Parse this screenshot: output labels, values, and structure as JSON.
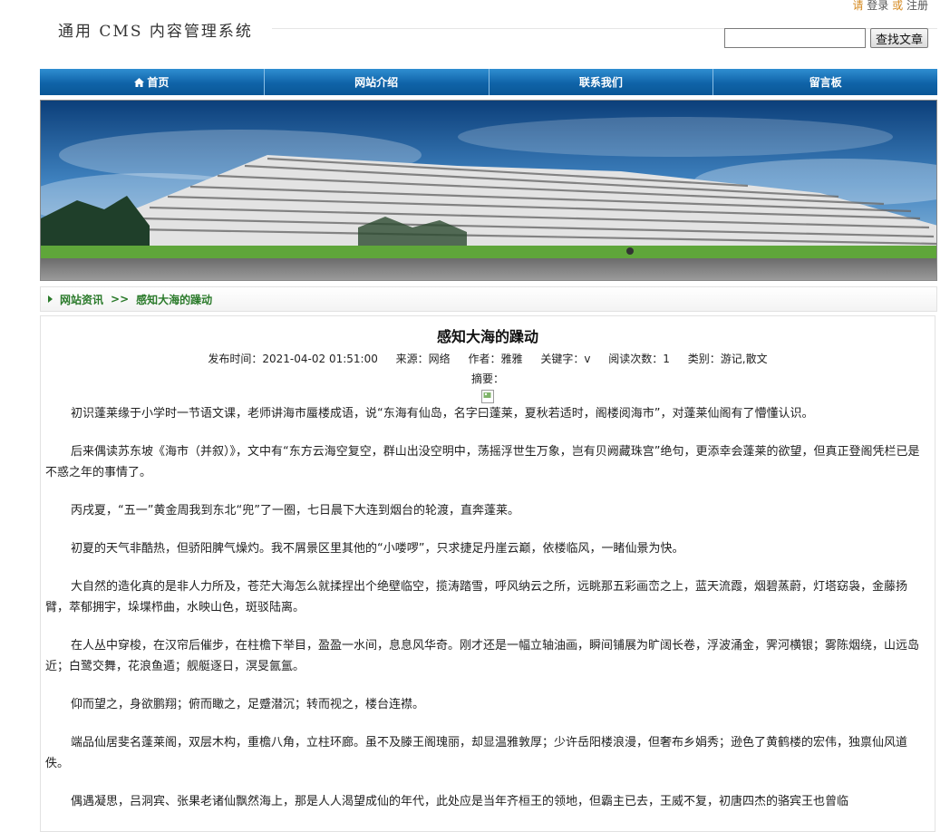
{
  "header": {
    "please": "请",
    "login": "登录",
    "or": "或",
    "register": "注册",
    "logo": "通用 CMS 内容管理系统",
    "search_value": "",
    "search_button": "查找文章"
  },
  "nav": {
    "items": [
      {
        "label": "首页",
        "icon": "home-icon"
      },
      {
        "label": "网站介绍"
      },
      {
        "label": "联系我们"
      },
      {
        "label": "留言板"
      }
    ]
  },
  "breadcrumb": {
    "root": "网站资讯",
    "separator": ">>",
    "current": "感知大海的躁动"
  },
  "article": {
    "title": "感知大海的躁动",
    "meta": {
      "publish_time": "发布时间：2021-04-02 01:51:00",
      "source": "来源：网络",
      "author": "作者：雅雅",
      "keywords": "关键字：v",
      "views": "阅读次数：1",
      "category": "类别：游记,散文"
    },
    "abstract_label": "摘要：",
    "paragraphs": [
      "初识蓬莱缘于小学时一节语文课，老师讲海市蜃楼成语，说“东海有仙岛，名字曰蓬莱，夏秋若适时，阁楼阅海市”，对蓬莱仙阁有了懵懂认识。",
      "后来偶读苏东坡《海市（并叙）》，文中有“东方云海空复空，群山出没空明中，荡摇浮世生万象，岂有贝阙藏珠宫”绝句，更添幸会蓬莱的欲望，但真正登阁凭栏已是不惑之年的事情了。",
      "丙戌夏，“五一”黄金周我到东北“兜”了一圈，七日晨下大连到烟台的轮渡，直奔蓬莱。",
      "初夏的天气非酷热，但骄阳脾气燥灼。我不屑景区里其他的“小喽啰”，只求捷足丹崖云巅，依楼临风，一睹仙景为快。",
      "大自然的造化真的是非人力所及，苍茫大海怎么就揉捏出个绝壁临空，揽涛踏雪，呼风纳云之所，远眺那五彩画峦之上，蓝天流霞，烟碧蒸蔚，灯塔窈袅，金藤扬臂，萃郁拥宇，垛堞栉曲，水映山色，斑驳陆离。",
      "在人丛中穿梭，在汉帘后催步，在柱檐下举目，盈盈一水间，息息风华奇。刚才还是一幅立轴油画，瞬间铺展为旷阔长卷，浮波涌金，霁河横银；雾陈烟绕，山远岛近；白鹭交舞，花浪鱼遁；舰艇逐日，溟旻氤氲。",
      "仰而望之，身欲鹏翔；俯而瞰之，足蹙潜沉；转而视之，楼台连襟。",
      "端品仙居斐名蓬莱阁，双层木构，重檐八角，立柱环廊。虽不及滕王阁瑰丽，却显温雅敦厚；少许岳阳楼浪漫，但奢布乡娟秀；逊色了黄鹤楼的宏伟，独禀仙风道佚。",
      "偶遇凝思，吕洞宾、张果老诸仙飘然海上，那是人人渴望成仙的年代，此处应是当年齐桓王的领地，但霸主已去，王威不复，初唐四杰的骆宾王也曾临"
    ]
  }
}
